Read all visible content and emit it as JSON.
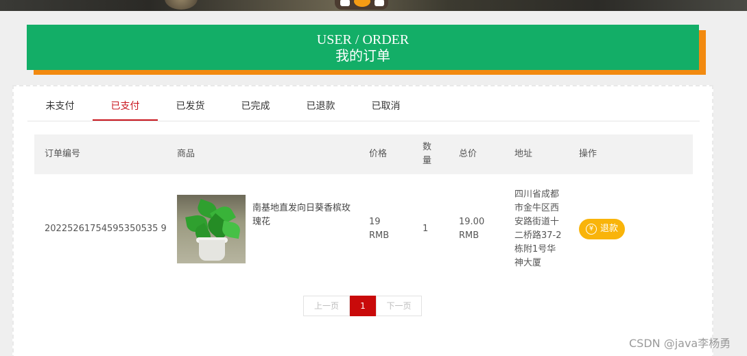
{
  "title": {
    "en": "USER / ORDER",
    "cn": "我的订单"
  },
  "tabs": [
    {
      "label": "未支付",
      "active": false
    },
    {
      "label": "已支付",
      "active": true
    },
    {
      "label": "已发货",
      "active": false
    },
    {
      "label": "已完成",
      "active": false
    },
    {
      "label": "已退款",
      "active": false
    },
    {
      "label": "已取消",
      "active": false
    }
  ],
  "table": {
    "headers": {
      "order_no": "订单编号",
      "product": "商品",
      "price": "价格",
      "qty": "数量",
      "total": "总价",
      "address": "地址",
      "action": "操作"
    },
    "rows": [
      {
        "order_no": "20225261754595350535 9",
        "product_name": "南基地直发向日葵香槟玫瑰花",
        "price": "19 RMB",
        "qty": "1",
        "total": "19.00 RMB",
        "address": "四川省成都市金牛区西安路街道十二桥路37-2栋附1号华神大厦",
        "action_label": "退款",
        "action_icon": "yen-circle-icon"
      }
    ]
  },
  "pager": {
    "prev": "上一页",
    "current": "1",
    "next": "下一页"
  },
  "watermark": "CSDN @java李杨勇",
  "colors": {
    "title_bg": "#13ae67",
    "title_shadow": "#f28a10",
    "active_tab": "#c9161e",
    "refund_button": "#f9b40a",
    "current_page": "#c90a0a"
  }
}
